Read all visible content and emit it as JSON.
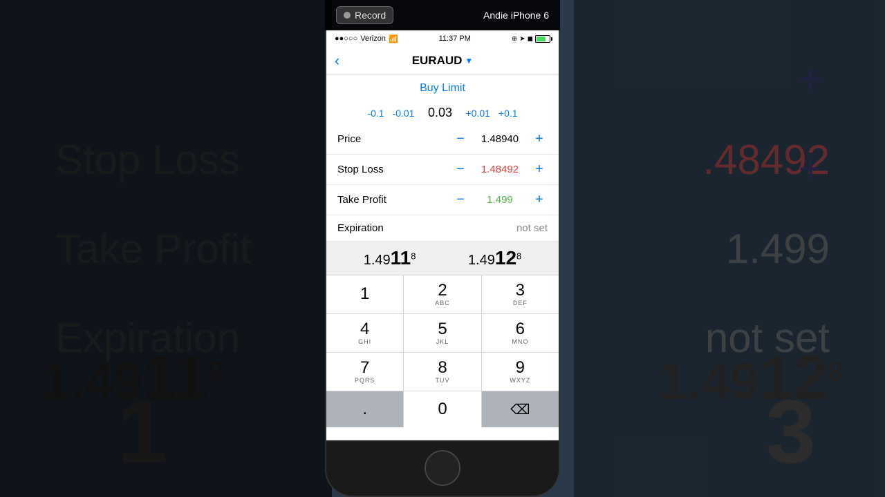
{
  "recording_bar": {
    "record_label": "Record",
    "device_name": "Andie iPhone 6"
  },
  "status_bar": {
    "carrier": "Verizon",
    "time": "11:37 PM",
    "icons": "⊕ ➤ ◼ ❋"
  },
  "nav": {
    "title": "EURAUD",
    "dropdown_arrow": "▼",
    "back_arrow": "‹"
  },
  "trade": {
    "type": "Buy Limit"
  },
  "volume": {
    "minus_large": "-0.1",
    "minus_small": "-0.01",
    "value": "0.03",
    "plus_small": "+0.01",
    "plus_large": "+0.1"
  },
  "fields": {
    "price": {
      "label": "Price",
      "value": "1.48940"
    },
    "stop_loss": {
      "label": "Stop Loss",
      "value": "1.48492"
    },
    "take_profit": {
      "label": "Take Profit",
      "value": "1.499"
    },
    "expiration": {
      "label": "Expiration",
      "value": "not set"
    }
  },
  "keypad_display": {
    "left_prefix": "1.49",
    "left_highlight": "11",
    "left_super": "8",
    "right_prefix": "1.49",
    "right_highlight": "12",
    "right_super": "8"
  },
  "keys": [
    {
      "num": "1",
      "sub": ""
    },
    {
      "num": "2",
      "sub": "ABC"
    },
    {
      "num": "3",
      "sub": "DEF"
    },
    {
      "num": "4",
      "sub": "GHI"
    },
    {
      "num": "5",
      "sub": "JKL"
    },
    {
      "num": "6",
      "sub": "MNO"
    },
    {
      "num": "7",
      "sub": "PQRS"
    },
    {
      "num": "8",
      "sub": "TUV"
    },
    {
      "num": "9",
      "sub": "WXYZ"
    },
    {
      "num": ".",
      "sub": ""
    },
    {
      "num": "0",
      "sub": ""
    },
    {
      "num": "⌫",
      "sub": ""
    }
  ],
  "bg": {
    "stop_loss": "Stop Loss",
    "take_profit": "Take Profit",
    "expiration": "Expiration",
    "red_number": ".48492",
    "green_number": "1.499",
    "not_set": "not set",
    "bottom_left": "1",
    "bottom_right": "3",
    "large_left": "1.4911",
    "large_right": "1.4912"
  }
}
